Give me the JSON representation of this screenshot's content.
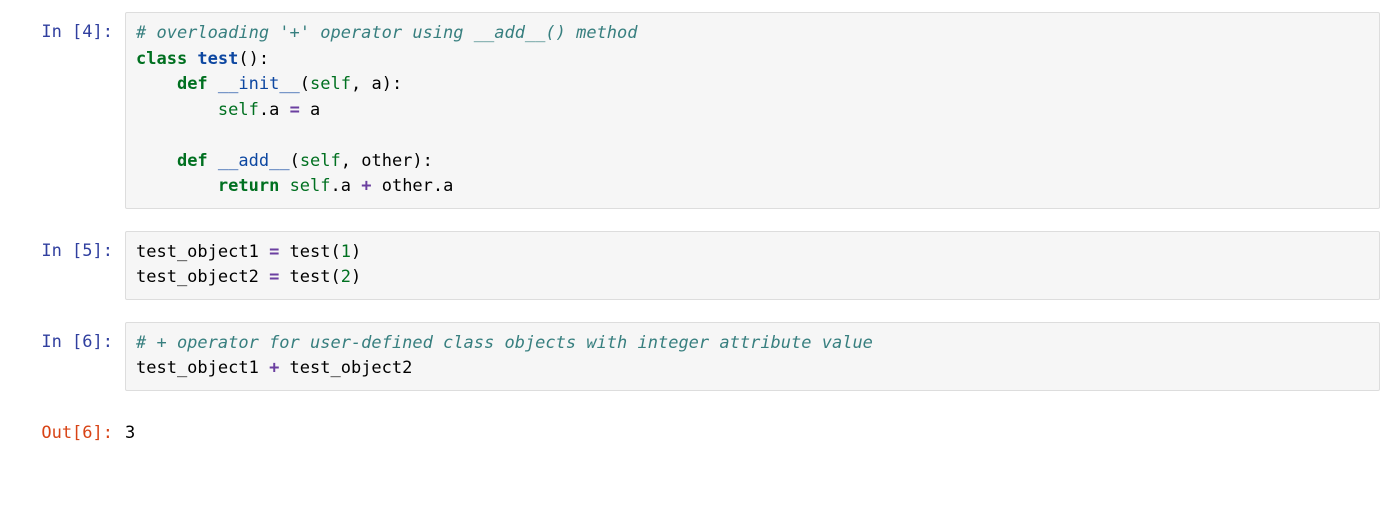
{
  "cells": [
    {
      "prompt": "In [4]:",
      "type": "in",
      "code": {
        "l0_comment": "# overloading '+' operator using __add__() method",
        "l1_kw": "class",
        "l1_name": " test",
        "l1_rest": "():",
        "l2_pad": "    ",
        "l2_kw": "def",
        "l2_name": " __init__",
        "l2_rest": "(",
        "l2_self": "self",
        "l2_rest2": ", a):",
        "l3_pad": "        ",
        "l3_self": "self",
        "l3_dot": ".a ",
        "l3_eq": "=",
        "l3_val": " a",
        "blank": "",
        "l4_pad": "    ",
        "l4_kw": "def",
        "l4_name": " __add__",
        "l4_rest": "(",
        "l4_self": "self",
        "l4_rest2": ", other):",
        "l5_pad": "        ",
        "l5_kw": "return",
        "l5_a": " ",
        "l5_self": "self",
        "l5_b": ".a ",
        "l5_plus": "+",
        "l5_c": " other.a"
      }
    },
    {
      "prompt": "In [5]:",
      "type": "in",
      "code": {
        "l0_a": "test_object1 ",
        "l0_eq": "=",
        "l0_b": " test(",
        "l0_n": "1",
        "l0_c": ")",
        "l1_a": "test_object2 ",
        "l1_eq": "=",
        "l1_b": " test(",
        "l1_n": "2",
        "l1_c": ")"
      }
    },
    {
      "prompt": "In [6]:",
      "type": "in",
      "code": {
        "l0_comment": "# + operator for user-defined class objects with integer attribute value",
        "l1_a": "test_object1 ",
        "l1_plus": "+",
        "l1_b": " test_object2"
      }
    },
    {
      "prompt": "Out[6]:",
      "type": "out",
      "output": "3"
    }
  ]
}
